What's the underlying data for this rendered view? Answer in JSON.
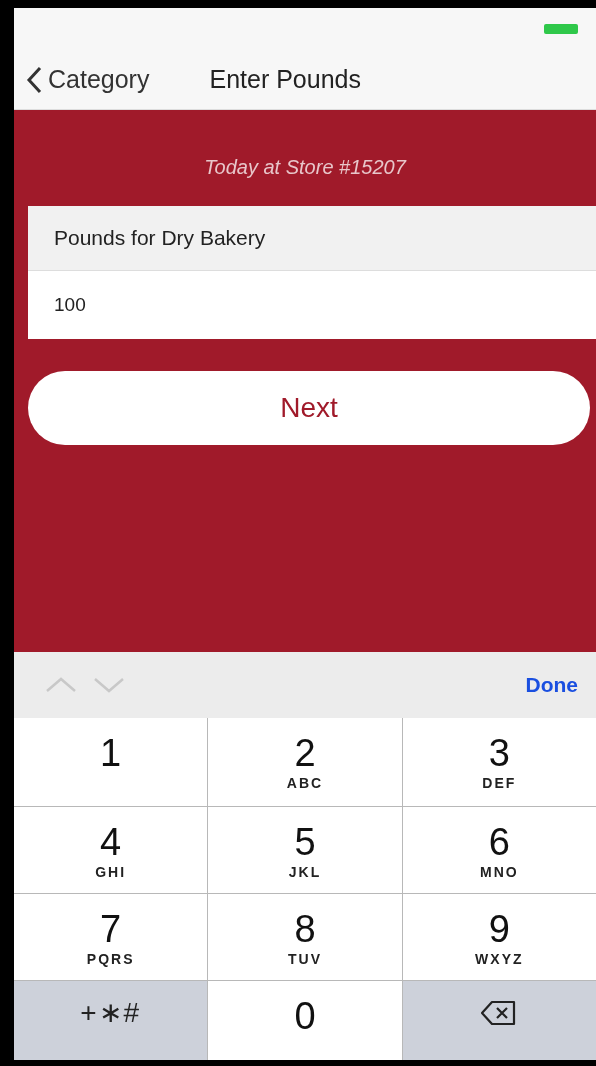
{
  "nav": {
    "back": "Category",
    "title": "Enter Pounds"
  },
  "subtitle": "Today at Store #15207",
  "form": {
    "label": "Pounds for Dry Bakery",
    "value": "100"
  },
  "next_button": "Next",
  "accessory": {
    "previous_disabled": true,
    "next_disabled": true,
    "done": "Done"
  },
  "keys": [
    {
      "kind": "digit",
      "digit": "1"
    },
    {
      "kind": "digit",
      "digit": "2",
      "letters": "ABC"
    },
    {
      "kind": "digit",
      "digit": "3",
      "letters": "DEF"
    },
    {
      "kind": "digit",
      "digit": "4",
      "letters": "GHI"
    },
    {
      "kind": "digit",
      "digit": "5",
      "letters": "JKL"
    },
    {
      "kind": "digit",
      "digit": "6",
      "letters": "MNO"
    },
    {
      "kind": "digit",
      "digit": "7",
      "letters": "PQRS"
    },
    {
      "kind": "digit",
      "digit": "8",
      "letters": "TUV"
    },
    {
      "kind": "digit",
      "digit": "9",
      "letters": "WXYZ"
    },
    {
      "kind": "symbols",
      "label": "+∗#"
    },
    {
      "kind": "digit",
      "digit": "0"
    },
    {
      "kind": "delete"
    }
  ]
}
